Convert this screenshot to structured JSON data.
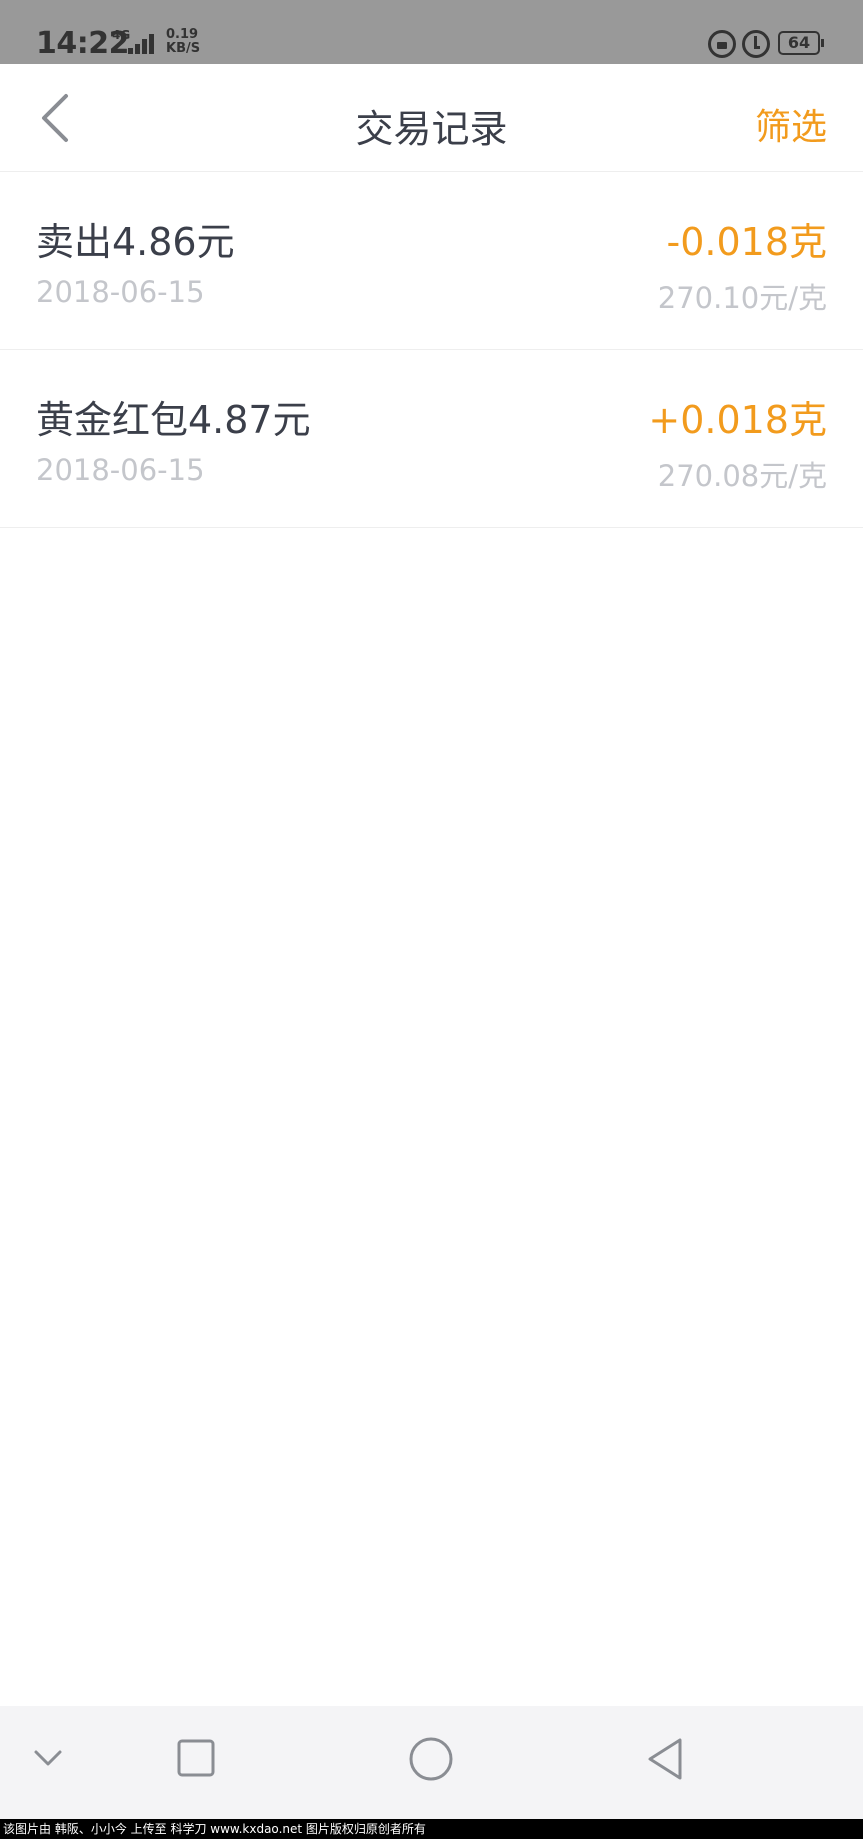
{
  "status_bar": {
    "time": "14:22",
    "network": "4G",
    "speed_value": "0.19",
    "speed_unit": "KB/S",
    "battery": "64",
    "icons": [
      "signal-icon",
      "rotation-lock-icon",
      "alarm-icon",
      "battery-icon"
    ]
  },
  "nav": {
    "back_icon": "chevron-left-icon",
    "title": "交易记录",
    "filter_label": "筛选"
  },
  "records": [
    {
      "title": "卖出4.86元",
      "date": "2018-06-15",
      "amount": "-0.018克",
      "price": "270.10元/克"
    },
    {
      "title": "黄金红包4.87元",
      "date": "2018-06-15",
      "amount": "+0.018克",
      "price": "270.08元/克"
    }
  ],
  "system_nav": {
    "icons": [
      "chevron-down-icon",
      "recents-square-icon",
      "home-circle-icon",
      "back-triangle-icon"
    ]
  },
  "watermark": "该图片由 韩阪、小小今 上传至 科学刀 www.kxdao.net 图片版权归原创者所有",
  "colors": {
    "accent": "#f29b1d",
    "primary_text": "#3b3f4a",
    "secondary_text": "#c4c6cb",
    "status_bar_bg": "#999999"
  }
}
